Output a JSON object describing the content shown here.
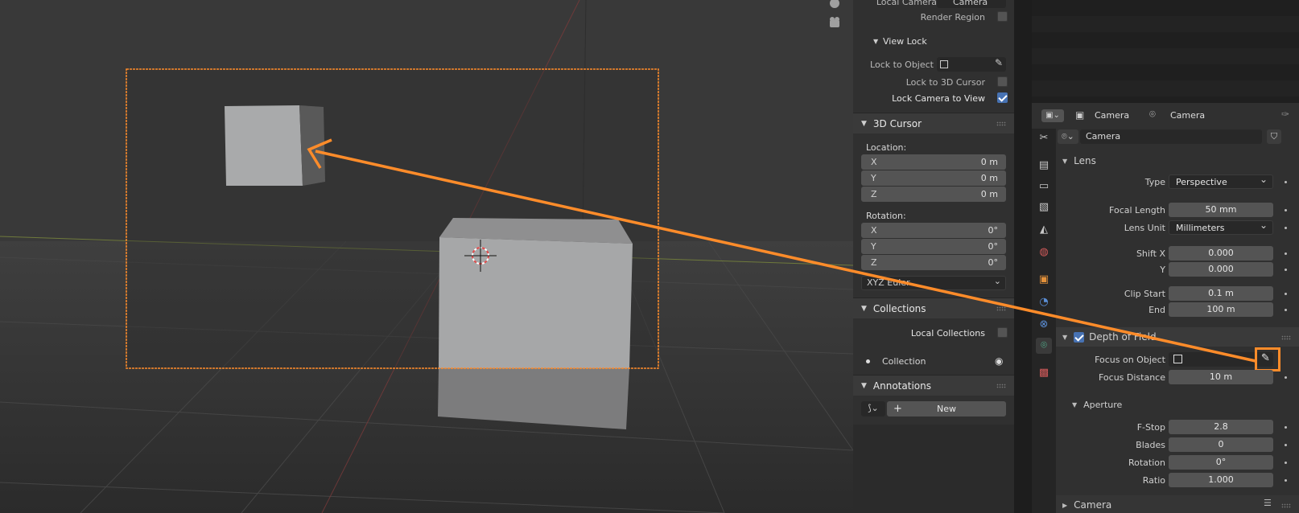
{
  "n_panel": {
    "local_camera_label": "Local Camera",
    "local_camera_value": "Camera",
    "render_region_label": "Render Region",
    "view_lock_title": "View Lock",
    "lock_to_object_label": "Lock to Object",
    "lock_to_3d_cursor_label": "Lock to 3D Cursor",
    "lock_camera_to_view_label": "Lock Camera to View",
    "cursor_title": "3D Cursor",
    "location_label": "Location:",
    "rotation_label": "Rotation:",
    "loc": [
      {
        "axis": "X",
        "value": "0 m"
      },
      {
        "axis": "Y",
        "value": "0 m"
      },
      {
        "axis": "Z",
        "value": "0 m"
      }
    ],
    "rot": [
      {
        "axis": "X",
        "value": "0°"
      },
      {
        "axis": "Y",
        "value": "0°"
      },
      {
        "axis": "Z",
        "value": "0°"
      }
    ],
    "rotation_mode": "XYZ Euler",
    "collections_title": "Collections",
    "local_collections_label": "Local Collections",
    "collection_item": "Collection",
    "annotations_title": "Annotations",
    "new_label": "New"
  },
  "props": {
    "breadcrumb_object": "Camera",
    "breadcrumb_data": "Camera",
    "datablock_name": "Camera",
    "lens_title": "Lens",
    "type_label": "Type",
    "type_value": "Perspective",
    "focal_length_label": "Focal Length",
    "focal_length_value": "50 mm",
    "lens_unit_label": "Lens Unit",
    "lens_unit_value": "Millimeters",
    "shift_x_label": "Shift X",
    "shift_x_value": "0.000",
    "shift_y_label": "Y",
    "shift_y_value": "0.000",
    "clip_start_label": "Clip Start",
    "clip_start_value": "0.1 m",
    "clip_end_label": "End",
    "clip_end_value": "100 m",
    "dof_title": "Depth of Field",
    "focus_object_label": "Focus on Object",
    "focus_distance_label": "Focus Distance",
    "focus_distance_value": "10 m",
    "aperture_title": "Aperture",
    "fstop_label": "F-Stop",
    "fstop_value": "2.8",
    "blades_label": "Blades",
    "blades_value": "0",
    "rotation_label": "Rotation",
    "rotation_value": "0°",
    "ratio_label": "Ratio",
    "ratio_value": "1.000",
    "camera_section_title": "Camera"
  },
  "colors": {
    "accent_orange": "#ff8c2a",
    "checkbox_blue": "#4772b3",
    "active_tab_green": "#59d0a4"
  }
}
